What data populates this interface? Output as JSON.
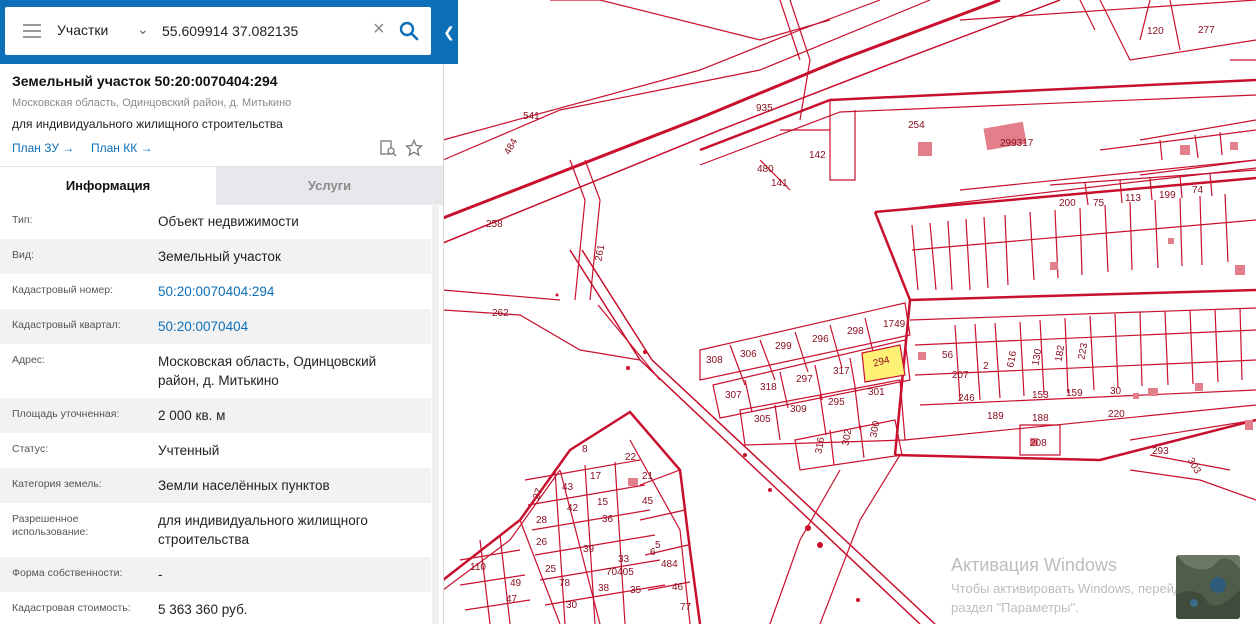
{
  "search": {
    "layer": "Участки",
    "query": "55.609914 37.082135"
  },
  "parcel": {
    "title": "Земельный участок 50:20:0070404:294",
    "address_line": "Московская область, Одинцовский район, д. Митькино",
    "usage": "для индивидуального жилищного строительства",
    "plan_zu": "План ЗУ →",
    "plan_kk": "План КК →"
  },
  "tabs": {
    "info": "Информация",
    "services": "Услуги"
  },
  "rows": [
    {
      "k": "Тип:",
      "v": "Объект недвижимости"
    },
    {
      "k": "Вид:",
      "v": "Земельный участок"
    },
    {
      "k": "Кадастровый номер:",
      "v": "50:20:0070404:294"
    },
    {
      "k": "Кадастровый квартал:",
      "v": "50:20:0070404"
    },
    {
      "k": "Адрес:",
      "v": "Московская область, Одинцовский район, д. Митькино"
    },
    {
      "k": "Площадь уточненная:",
      "v": "2 000 кв. м"
    },
    {
      "k": "Статус:",
      "v": "Учтенный"
    },
    {
      "k": "Категория земель:",
      "v": "Земли населённых пунктов"
    },
    {
      "k": "Разрешенное использование:",
      "v": "для индивидуального жилищного строительства"
    },
    {
      "k": "Форма собственности:",
      "v": "-"
    },
    {
      "k": "Кадастровая стоимость:",
      "v": "5 363 360 руб."
    }
  ],
  "map": {
    "line_color": "#c8102e",
    "highlight_color": "#fff176",
    "labels": {
      "l541": "541",
      "l484": "484",
      "l935": "935",
      "l142": "142",
      "l480": "480",
      "l141": "141",
      "l254": "254",
      "l299317": "299317",
      "l120": "120",
      "l277": "277",
      "l258": "258",
      "l261": "261",
      "l262": "262",
      "l308": "308",
      "l306": "306",
      "l299": "299",
      "l296": "296",
      "l298": "298",
      "l1749": "1749",
      "l294": "294",
      "l307": "307",
      "l318": "318",
      "l297": "297",
      "l317": "317",
      "l301": "301",
      "l305": "305",
      "l309": "309",
      "l295": "295",
      "l316": "316",
      "l302": "302",
      "l300": "300",
      "l200": "200",
      "l75": "75",
      "l113": "113",
      "l199": "199",
      "l74": "74",
      "l56": "56",
      "l207": "207",
      "l2": "2",
      "l616": "616",
      "l130": "130",
      "l182": "182",
      "l223": "223",
      "l246": "246",
      "l189": "189",
      "l153": "153",
      "l159": "159",
      "l30": "30",
      "l220": "220",
      "l188": "188",
      "l208": "208",
      "l293": "293",
      "l303": "303",
      "l70405": "70405",
      "l22": "22",
      "l21": "21",
      "l45": "45",
      "l43": "43",
      "l17": "17",
      "l42": "42",
      "l15": "15",
      "l36": "36",
      "l6": "6",
      "l5": "5",
      "l484b": "484",
      "l46": "46",
      "l77": "77",
      "l39": "39",
      "l33": "33",
      "l38": "38",
      "l35": "35",
      "l30b": "30",
      "l78": "78",
      "l26": "26",
      "l25": "25",
      "l28": "28",
      "l8": "8",
      "l27": "27",
      "l110": "110",
      "l49": "49",
      "l47": "47"
    }
  },
  "watermark": {
    "title": "Активация Windows",
    "line1": "Чтобы активировать Windows, перейдите в",
    "line2": "раздел \"Параметры\"."
  }
}
